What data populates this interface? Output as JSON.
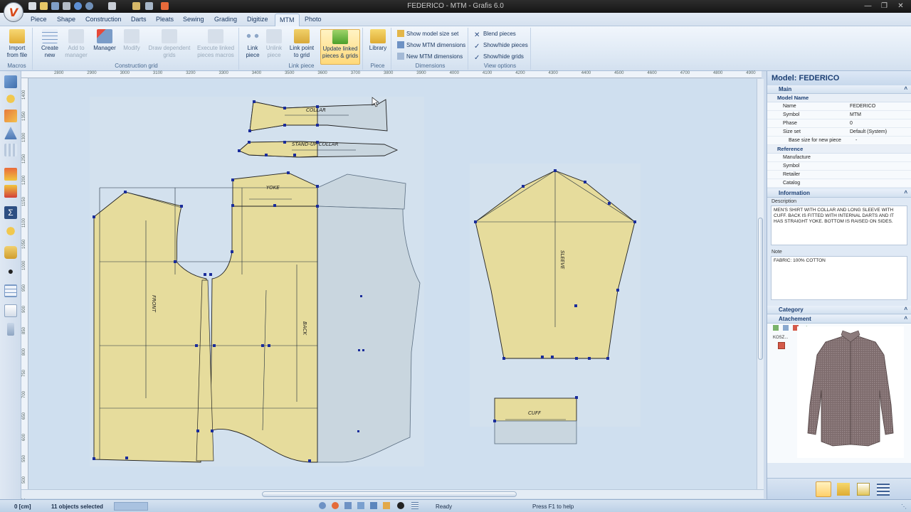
{
  "app": {
    "window_title": "FEDERICO - MTM - Grafis 6.0",
    "window_controls": [
      "minimize-icon",
      "restore-icon",
      "close-icon"
    ]
  },
  "menu": {
    "tabs": [
      "Piece",
      "Shape",
      "Construction",
      "Darts",
      "Pleats",
      "Sewing",
      "Grading",
      "Digitize",
      "MTM",
      "Photo"
    ],
    "active": "MTM"
  },
  "ribbon": {
    "groups": [
      {
        "label": "Macros",
        "buttons": [
          {
            "label": "Import from file",
            "icon": "folder-open-icon"
          }
        ]
      },
      {
        "label": "Construction grid",
        "buttons": [
          {
            "label": "Create new",
            "icon": "grid-new-icon"
          },
          {
            "label": "Add to manager",
            "icon": "grid-add-icon",
            "disabled": true
          },
          {
            "label": "Manager",
            "icon": "grid-manager-icon"
          },
          {
            "label": "Modify",
            "icon": "grid-modify-icon",
            "disabled": true
          },
          {
            "label": "Draw dependent grids",
            "icon": "grid-draw-icon",
            "disabled": true
          },
          {
            "label": "Execute linked pieces macros",
            "icon": "macro-run-icon",
            "disabled": true
          }
        ]
      },
      {
        "label": "Link piece",
        "buttons": [
          {
            "label": "Link piece",
            "icon": "link-icon"
          },
          {
            "label": "Unlink piece",
            "icon": "unlink-icon",
            "disabled": true
          },
          {
            "label": "Link point to grid",
            "icon": "link-point-icon"
          },
          {
            "label": "Update linked pieces & grids",
            "icon": "update-linked-icon",
            "highlight": true
          }
        ]
      },
      {
        "label": "Piece",
        "buttons": [
          {
            "label": "Library",
            "icon": "library-icon"
          }
        ]
      },
      {
        "label": "Dimensions",
        "small": [
          "Show model size set",
          "Show MTM dimensions",
          "New MTM dimensions"
        ]
      },
      {
        "label": "View options",
        "small": [
          "Blend pieces",
          "Show/hide pieces",
          "Show/hide grids"
        ]
      }
    ]
  },
  "ruler": {
    "h_labels": [
      "2800",
      "2900",
      "3000",
      "3100",
      "3200",
      "3300",
      "3400",
      "3500",
      "3600",
      "3700",
      "3800",
      "3900",
      "4000",
      "4100",
      "4200",
      "4300",
      "4400",
      "4500",
      "4600",
      "4700",
      "4800",
      "4900"
    ],
    "v_labels": [
      "1400",
      "1350",
      "1300",
      "1250",
      "1200",
      "1150",
      "1100",
      "1050",
      "1000",
      "950",
      "900",
      "850",
      "800",
      "750",
      "700",
      "650",
      "600",
      "550",
      "500",
      "450"
    ]
  },
  "canvas": {
    "pieces": [
      "COLLAR",
      "STAND-UP COLLAR",
      "YOKE",
      "FRONT",
      "BACK",
      "SLEEVE",
      "CUFF"
    ]
  },
  "panel": {
    "title": "Model: FEDERICO",
    "main_section": "Main",
    "model_name_group": "Model Name",
    "fields": [
      {
        "key": "Name",
        "value": "FEDERICO"
      },
      {
        "key": "Symbol",
        "value": "MTM"
      },
      {
        "key": "Phase",
        "value": "0"
      },
      {
        "key": "Size set",
        "value": "Default (System)"
      },
      {
        "key": "Base size for new piece",
        "value": "-"
      }
    ],
    "reference_group": "Reference",
    "reference_fields": [
      "Manufacture",
      "Symbol",
      "Retailer",
      "Catalog"
    ],
    "information_section": "Information",
    "description_label": "Description",
    "description": "MEN'S SHIRT WITH COLLAR AND LONG SLEEVE WITH CUFF. BACK IS FITTED WITH INTERNAL DARTS AND IT HAS STRAIGHT YOKE. BOTTOM IS RAISED ON SIDES.",
    "note_label": "Note",
    "note": "FABRIC: 100% COTTON",
    "category_section": "Category",
    "attachment_section": "Atachement",
    "attachment_file": "KOSZ...",
    "bottom_tools": [
      "model-icon",
      "pieces-icon",
      "document-icon",
      "list-icon"
    ]
  },
  "status": {
    "units": "0 [cm]",
    "selection": "11 objects selected",
    "ready": "Ready",
    "help": "Press F1 to help"
  },
  "colors": {
    "piece_fill": "#e6dc9c",
    "piece_fill_dim": "#c9d6df",
    "canvas_bg": "#cfdfef",
    "point": "#1a2c9a"
  }
}
